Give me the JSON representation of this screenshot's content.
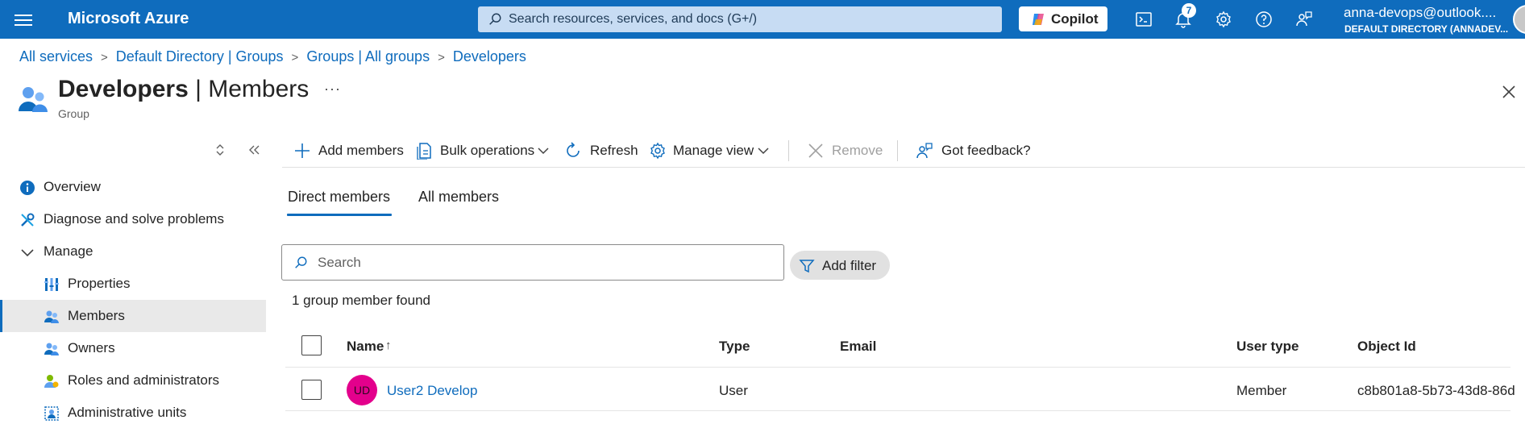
{
  "topbar": {
    "brand": "Microsoft Azure",
    "search_placeholder": "Search resources, services, and docs (G+/)",
    "copilot_label": "Copilot",
    "notifications_count": "7",
    "account_email": "anna-devops@outlook....",
    "account_directory": "DEFAULT DIRECTORY (ANNADEV..."
  },
  "breadcrumb": [
    "All services",
    "Default Directory | Groups",
    "Groups | All groups",
    "Developers"
  ],
  "page": {
    "title_bold": "Developers",
    "title_rest": " | Members",
    "more": "···",
    "subtitle": "Group"
  },
  "sidebar": {
    "items": [
      {
        "label": "Overview",
        "icon": "info-icon"
      },
      {
        "label": "Diagnose and solve problems",
        "icon": "wrench-icon"
      },
      {
        "label": "Manage",
        "icon": "chevron-down-icon"
      },
      {
        "label": "Properties",
        "icon": "properties-icon"
      },
      {
        "label": "Members",
        "icon": "members-icon",
        "active": true
      },
      {
        "label": "Owners",
        "icon": "owners-icon"
      },
      {
        "label": "Roles and administrators",
        "icon": "roles-icon"
      },
      {
        "label": "Administrative units",
        "icon": "admin-units-icon"
      }
    ]
  },
  "toolbar": {
    "add_members": "Add members",
    "bulk_operations": "Bulk operations",
    "refresh": "Refresh",
    "manage_view": "Manage view",
    "remove": "Remove",
    "feedback": "Got feedback?"
  },
  "tabs": [
    {
      "label": "Direct members",
      "active": true
    },
    {
      "label": "All members",
      "active": false
    }
  ],
  "filter": {
    "search_placeholder": "Search",
    "add_filter": "Add filter",
    "result_text": "1 group member found"
  },
  "table": {
    "columns": [
      "Name",
      "Type",
      "Email",
      "User type",
      "Object Id"
    ],
    "sort_indicator": "↑",
    "rows": [
      {
        "initials": "UD",
        "name": "User2 Develop",
        "type": "User",
        "email": "",
        "user_type": "Member",
        "object_id": "c8b801a8-5b73-43d8-86d"
      }
    ]
  },
  "colors": {
    "brand_blue": "#0f6cbd",
    "avatar_pink": "#e3008c",
    "active_bg": "#e9e9e9"
  }
}
